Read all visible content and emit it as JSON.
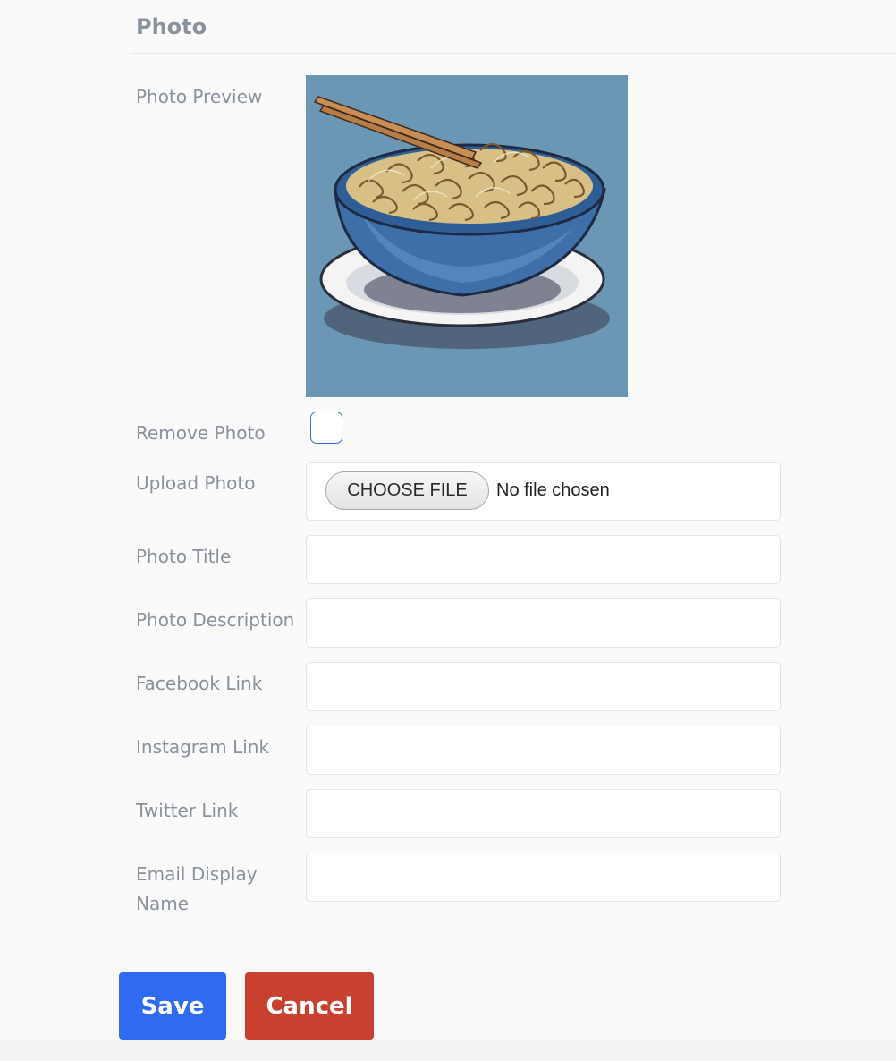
{
  "section": {
    "title": "Photo"
  },
  "fields": {
    "photo_preview_label": "Photo Preview",
    "remove_photo_label": "Remove Photo",
    "upload_photo_label": "Upload Photo",
    "choose_file_button": "CHOOSE FILE",
    "no_file_text": "No file chosen",
    "photo_title_label": "Photo Title",
    "photo_title_value": "",
    "photo_description_label": "Photo Description",
    "photo_description_value": "",
    "facebook_link_label": "Facebook Link",
    "facebook_link_value": "",
    "instagram_link_label": "Instagram Link",
    "instagram_link_value": "",
    "twitter_link_label": "Twitter Link",
    "twitter_link_value": "",
    "email_display_name_label": "Email Display Name",
    "email_display_name_value": ""
  },
  "remove_photo_checked": false,
  "buttons": {
    "save": "Save",
    "cancel": "Cancel"
  },
  "colors": {
    "label": "#8a929c",
    "save": "#2f6bf0",
    "cancel": "#c8402f",
    "preview_background": "#6b97b4"
  }
}
